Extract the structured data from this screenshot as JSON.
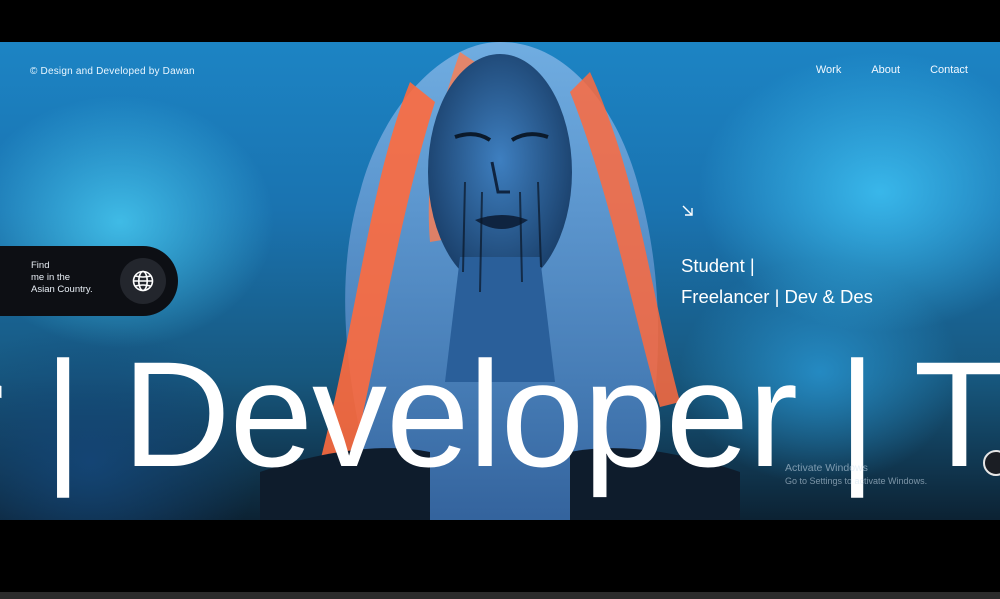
{
  "header": {
    "credit": "© Design and Developed by Dawan",
    "nav": [
      {
        "label": "Work"
      },
      {
        "label": "About"
      },
      {
        "label": "Contact"
      }
    ]
  },
  "location_pill": {
    "line1": "Find",
    "line2": "me in the",
    "line3": "Asian Country.",
    "icon": "globe-icon"
  },
  "tagline": {
    "arrow_icon": "arrow-down-right-icon",
    "line1": "Student |",
    "line2": "Freelancer | Dev & Des"
  },
  "marquee": {
    "text": "r | Developer | T"
  },
  "overlay": {
    "line1": "Activate Windows",
    "line2": "Go to Settings to activate Windows."
  },
  "colors": {
    "sky": "#1c84c4",
    "hair_accent": "#ff6a3d",
    "pill_bg": "#0d0f14",
    "text": "#ffffff"
  }
}
